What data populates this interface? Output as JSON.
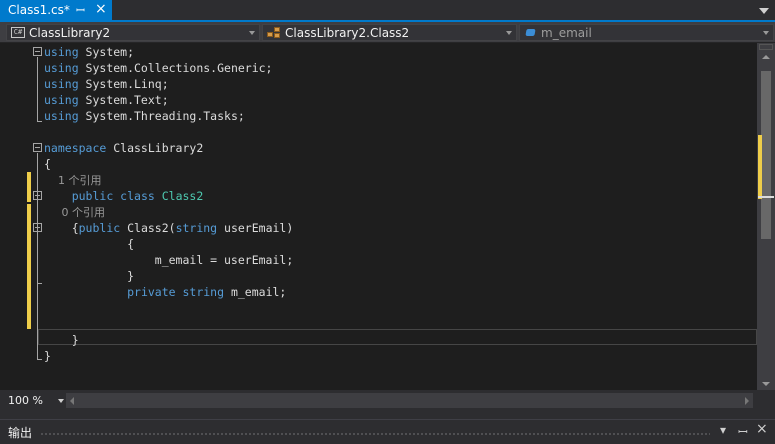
{
  "tab": {
    "title": "Class1.cs*",
    "pin_glyph": "ꟷ",
    "close_glyph": "×"
  },
  "navbar": {
    "project": "ClassLibrary2",
    "project_icon_text": "C#",
    "class": "ClassLibrary2.Class2",
    "member": "m_email"
  },
  "code": [
    {
      "parts": [
        [
          "kw",
          "using"
        ],
        [
          "",
          " System;"
        ]
      ]
    },
    {
      "parts": [
        [
          "kw",
          "using"
        ],
        [
          "",
          " System.Collections.Generic;"
        ]
      ]
    },
    {
      "parts": [
        [
          "kw",
          "using"
        ],
        [
          "",
          " System.Linq;"
        ]
      ]
    },
    {
      "parts": [
        [
          "kw",
          "using"
        ],
        [
          "",
          " System.Text;"
        ]
      ]
    },
    {
      "parts": [
        [
          "kw",
          "using"
        ],
        [
          "",
          " System.Threading.Tasks;"
        ]
      ]
    },
    {
      "parts": []
    },
    {
      "parts": [
        [
          "kw",
          "namespace"
        ],
        [
          "",
          " ClassLibrary2"
        ]
      ]
    },
    {
      "parts": [
        [
          "",
          "{"
        ]
      ]
    },
    {
      "parts": [
        [
          "cl",
          "    1 个引用"
        ]
      ]
    },
    {
      "parts": [
        [
          "",
          "    "
        ],
        [
          "kw",
          "public class"
        ],
        [
          "",
          " "
        ],
        [
          "ty",
          "Class2"
        ]
      ]
    },
    {
      "parts": [
        [
          "cl",
          "     0 个引用"
        ]
      ]
    },
    {
      "parts": [
        [
          "",
          "    {"
        ],
        [
          "kw",
          "public"
        ],
        [
          "",
          " Class2("
        ],
        [
          "kw",
          "string"
        ],
        [
          "",
          " userEmail)"
        ]
      ]
    },
    {
      "parts": [
        [
          "",
          "            {"
        ]
      ]
    },
    {
      "parts": [
        [
          "",
          "                m_email = userEmail;"
        ]
      ]
    },
    {
      "parts": [
        [
          "",
          "            }"
        ]
      ]
    },
    {
      "parts": [
        [
          "",
          "            "
        ],
        [
          "kw",
          "private string"
        ],
        [
          "",
          " m_email;"
        ]
      ]
    },
    {
      "parts": []
    },
    {
      "parts": []
    },
    {
      "parts": [
        [
          "",
          "    }"
        ]
      ]
    },
    {
      "parts": [
        [
          "",
          "}"
        ]
      ]
    }
  ],
  "zoom": {
    "label": "100 %"
  },
  "output_panel": {
    "title": "输出",
    "dropdown_glyph": "▾",
    "pin_glyph": "ꟷ",
    "close_glyph": "×"
  }
}
